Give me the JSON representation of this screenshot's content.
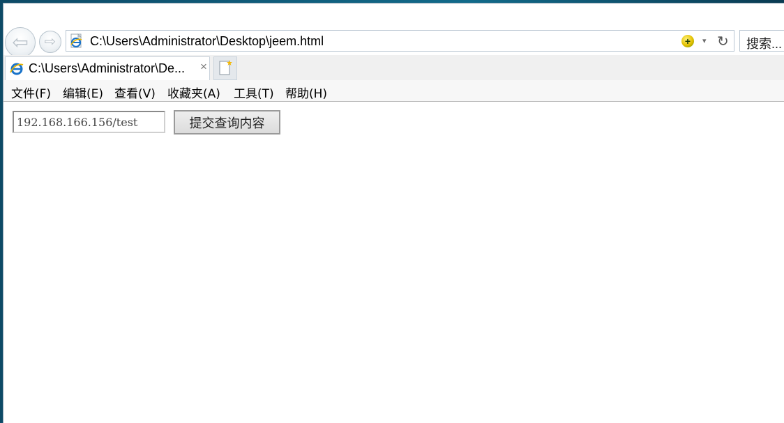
{
  "browser": {
    "address": "C:\\Users\\Administrator\\Desktop\\jeem.html",
    "search_placeholder": "搜索...",
    "tab_title": "C:\\Users\\Administrator\\De...",
    "tab_close": "×",
    "compat_icon_glyph": "+",
    "dropdown_glyph": "▾",
    "refresh_glyph": "↻",
    "back_glyph": "⇦",
    "forward_glyph": "⇨"
  },
  "menu": [
    {
      "label": "文件(F)"
    },
    {
      "label": "编辑(E)"
    },
    {
      "label": "查看(V)"
    },
    {
      "label": "收藏夹(A)"
    },
    {
      "label": "工具(T)"
    },
    {
      "label": "帮助(H)"
    }
  ],
  "page": {
    "input_value": "192.168.166.156/test",
    "submit_label": "提交查询内容"
  },
  "colors": {
    "ie_blue": "#1a73c9",
    "compat_yellow": "#e3c000"
  }
}
